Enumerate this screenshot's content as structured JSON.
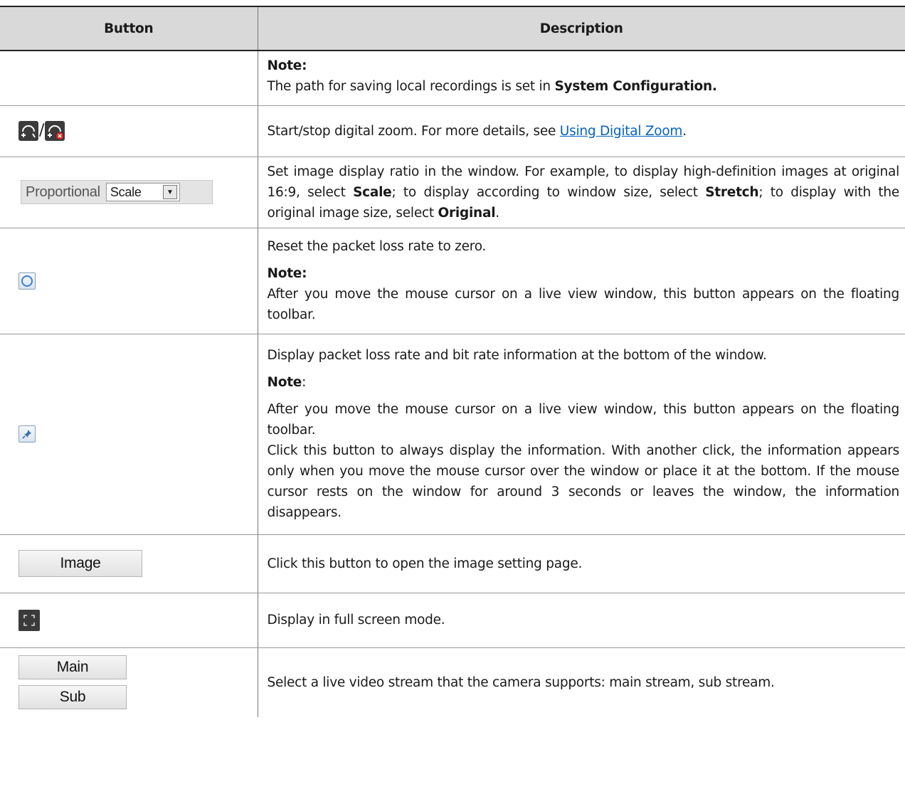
{
  "header": {
    "col_button": "Button",
    "col_description": "Description"
  },
  "rows": {
    "note_row": {
      "note_label": "Note:",
      "text_before": "The path for saving local recordings is set in ",
      "text_bold": "System Configuration."
    },
    "zoom": {
      "icon_names": [
        "start-digital-zoom-icon",
        "stop-digital-zoom-icon"
      ],
      "separator": "/",
      "text_before": "Start/stop digital zoom. For more details, see ",
      "link": "Using Digital Zoom",
      "text_after": "."
    },
    "ratio": {
      "label": "Proportional",
      "select_value": "Scale",
      "t1": "Set image display ratio in the window. For example, to display high-definition images at original 16:9, select ",
      "b1": "Scale",
      "t2": "; to display according to window size, select ",
      "b2": "Stretch",
      "t3": "; to display with the original image size, select ",
      "b3": "Original",
      "t4": "."
    },
    "reset": {
      "icon": "reset-circle-icon",
      "line1": "Reset the packet loss rate to zero.",
      "note_label": "Note:",
      "note_text": "After you move the mouse cursor on a live view window, this button appears on the floating toolbar."
    },
    "pin": {
      "icon": "pin-icon",
      "line1": "Display packet loss rate and bit rate information at the bottom of the window.",
      "note_label": "Note",
      "note_colon": ":",
      "para1": "After you move the mouse cursor on a live view window, this button appears on the floating toolbar.",
      "para2": "Click this button to always display the information. With another click, the information appears only when you move the mouse cursor over the window or place it at the bottom. If the mouse cursor rests on the window for around 3 seconds or leaves the window, the information disappears."
    },
    "image": {
      "button_label": "Image",
      "text": "Click this button to open the image setting page."
    },
    "fullscreen": {
      "icon": "fullscreen-icon",
      "text": "Display in full screen mode."
    },
    "stream": {
      "main_label": "Main",
      "sub_label": "Sub",
      "text": "Select a live video stream that the camera supports: main stream, sub stream."
    }
  },
  "colors": {
    "header_bg": "#d9d9d9",
    "link": "#0563c1",
    "icon_dark": "#3a3a3a",
    "accent_blue": "#3f7fc8"
  }
}
